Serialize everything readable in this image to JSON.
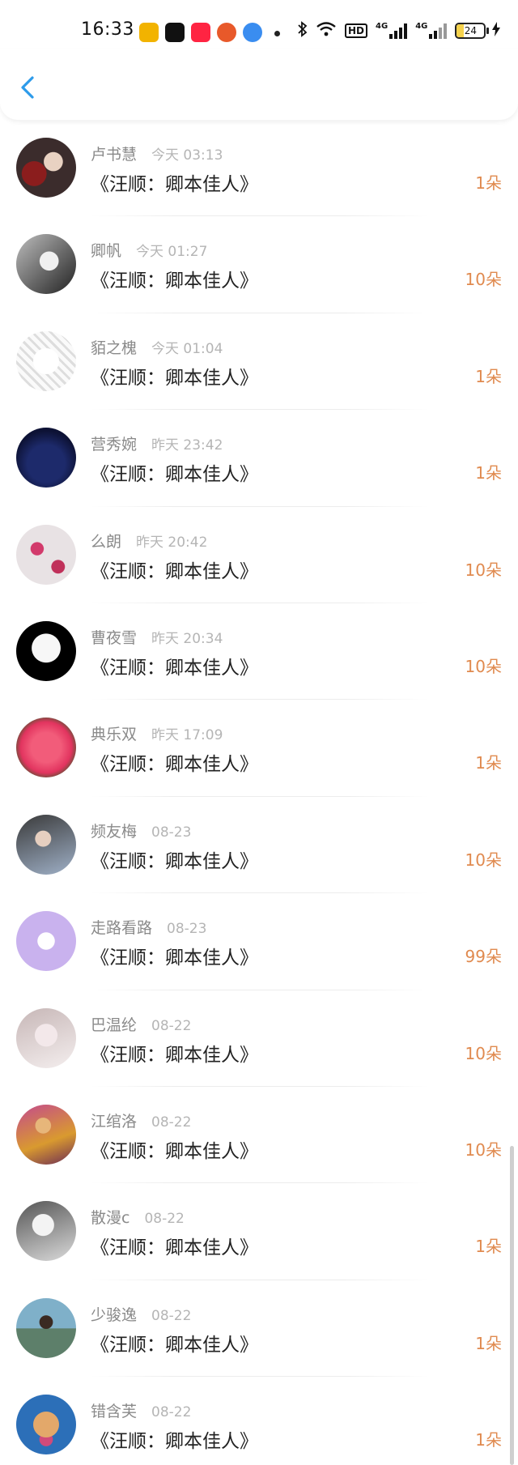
{
  "status_bar": {
    "time": "16:33",
    "app_icons": [
      {
        "name": "weibo-icon",
        "color": "#f2b300"
      },
      {
        "name": "douyin-icon",
        "color": "#111111"
      },
      {
        "name": "xiaohongshu-icon",
        "color": "#ff2442"
      },
      {
        "name": "app-icon-orange",
        "color": "#e8592a"
      },
      {
        "name": "app-icon-blue",
        "color": "#3a8df0"
      }
    ],
    "hd_label": "HD",
    "network_label_1": "4G",
    "network_label_2": "4G",
    "battery_level": "24"
  },
  "nav": {
    "back_icon": "chevron-left-icon",
    "accent_color": "#2d9bea"
  },
  "items": [
    {
      "name": "卢书慧",
      "time": "今天 03:13",
      "message": "《汪顺：卿本佳人》",
      "amount": "1朵"
    },
    {
      "name": "卿帆",
      "time": "今天 01:27",
      "message": "《汪顺：卿本佳人》",
      "amount": "10朵"
    },
    {
      "name": "貊之槐",
      "time": "今天 01:04",
      "message": "《汪顺：卿本佳人》",
      "amount": "1朵"
    },
    {
      "name": "营秀婉",
      "time": "昨天 23:42",
      "message": "《汪顺：卿本佳人》",
      "amount": "1朵"
    },
    {
      "name": "么朗",
      "time": "昨天 20:42",
      "message": "《汪顺：卿本佳人》",
      "amount": "10朵"
    },
    {
      "name": "曹夜雪",
      "time": "昨天 20:34",
      "message": "《汪顺：卿本佳人》",
      "amount": "10朵"
    },
    {
      "name": "典乐双",
      "time": "昨天 17:09",
      "message": "《汪顺：卿本佳人》",
      "amount": "1朵"
    },
    {
      "name": "频友梅",
      "time": "08-23",
      "message": "《汪顺：卿本佳人》",
      "amount": "10朵"
    },
    {
      "name": "走路看路",
      "time": "08-23",
      "message": "《汪顺：卿本佳人》",
      "amount": "99朵"
    },
    {
      "name": "巴温纶",
      "time": "08-22",
      "message": "《汪顺：卿本佳人》",
      "amount": "10朵"
    },
    {
      "name": "江绾洛",
      "time": "08-22",
      "message": "《汪顺：卿本佳人》",
      "amount": "10朵"
    },
    {
      "name": "散漫c",
      "time": "08-22",
      "message": "《汪顺：卿本佳人》",
      "amount": "1朵"
    },
    {
      "name": "少骏逸",
      "time": "08-22",
      "message": "《汪顺：卿本佳人》",
      "amount": "1朵"
    },
    {
      "name": "错含芙",
      "time": "08-22",
      "message": "《汪顺：卿本佳人》",
      "amount": "1朵"
    }
  ],
  "colors": {
    "amount": "#e08a4f",
    "name": "#8a8a8a",
    "time": "#b5b5b5"
  }
}
